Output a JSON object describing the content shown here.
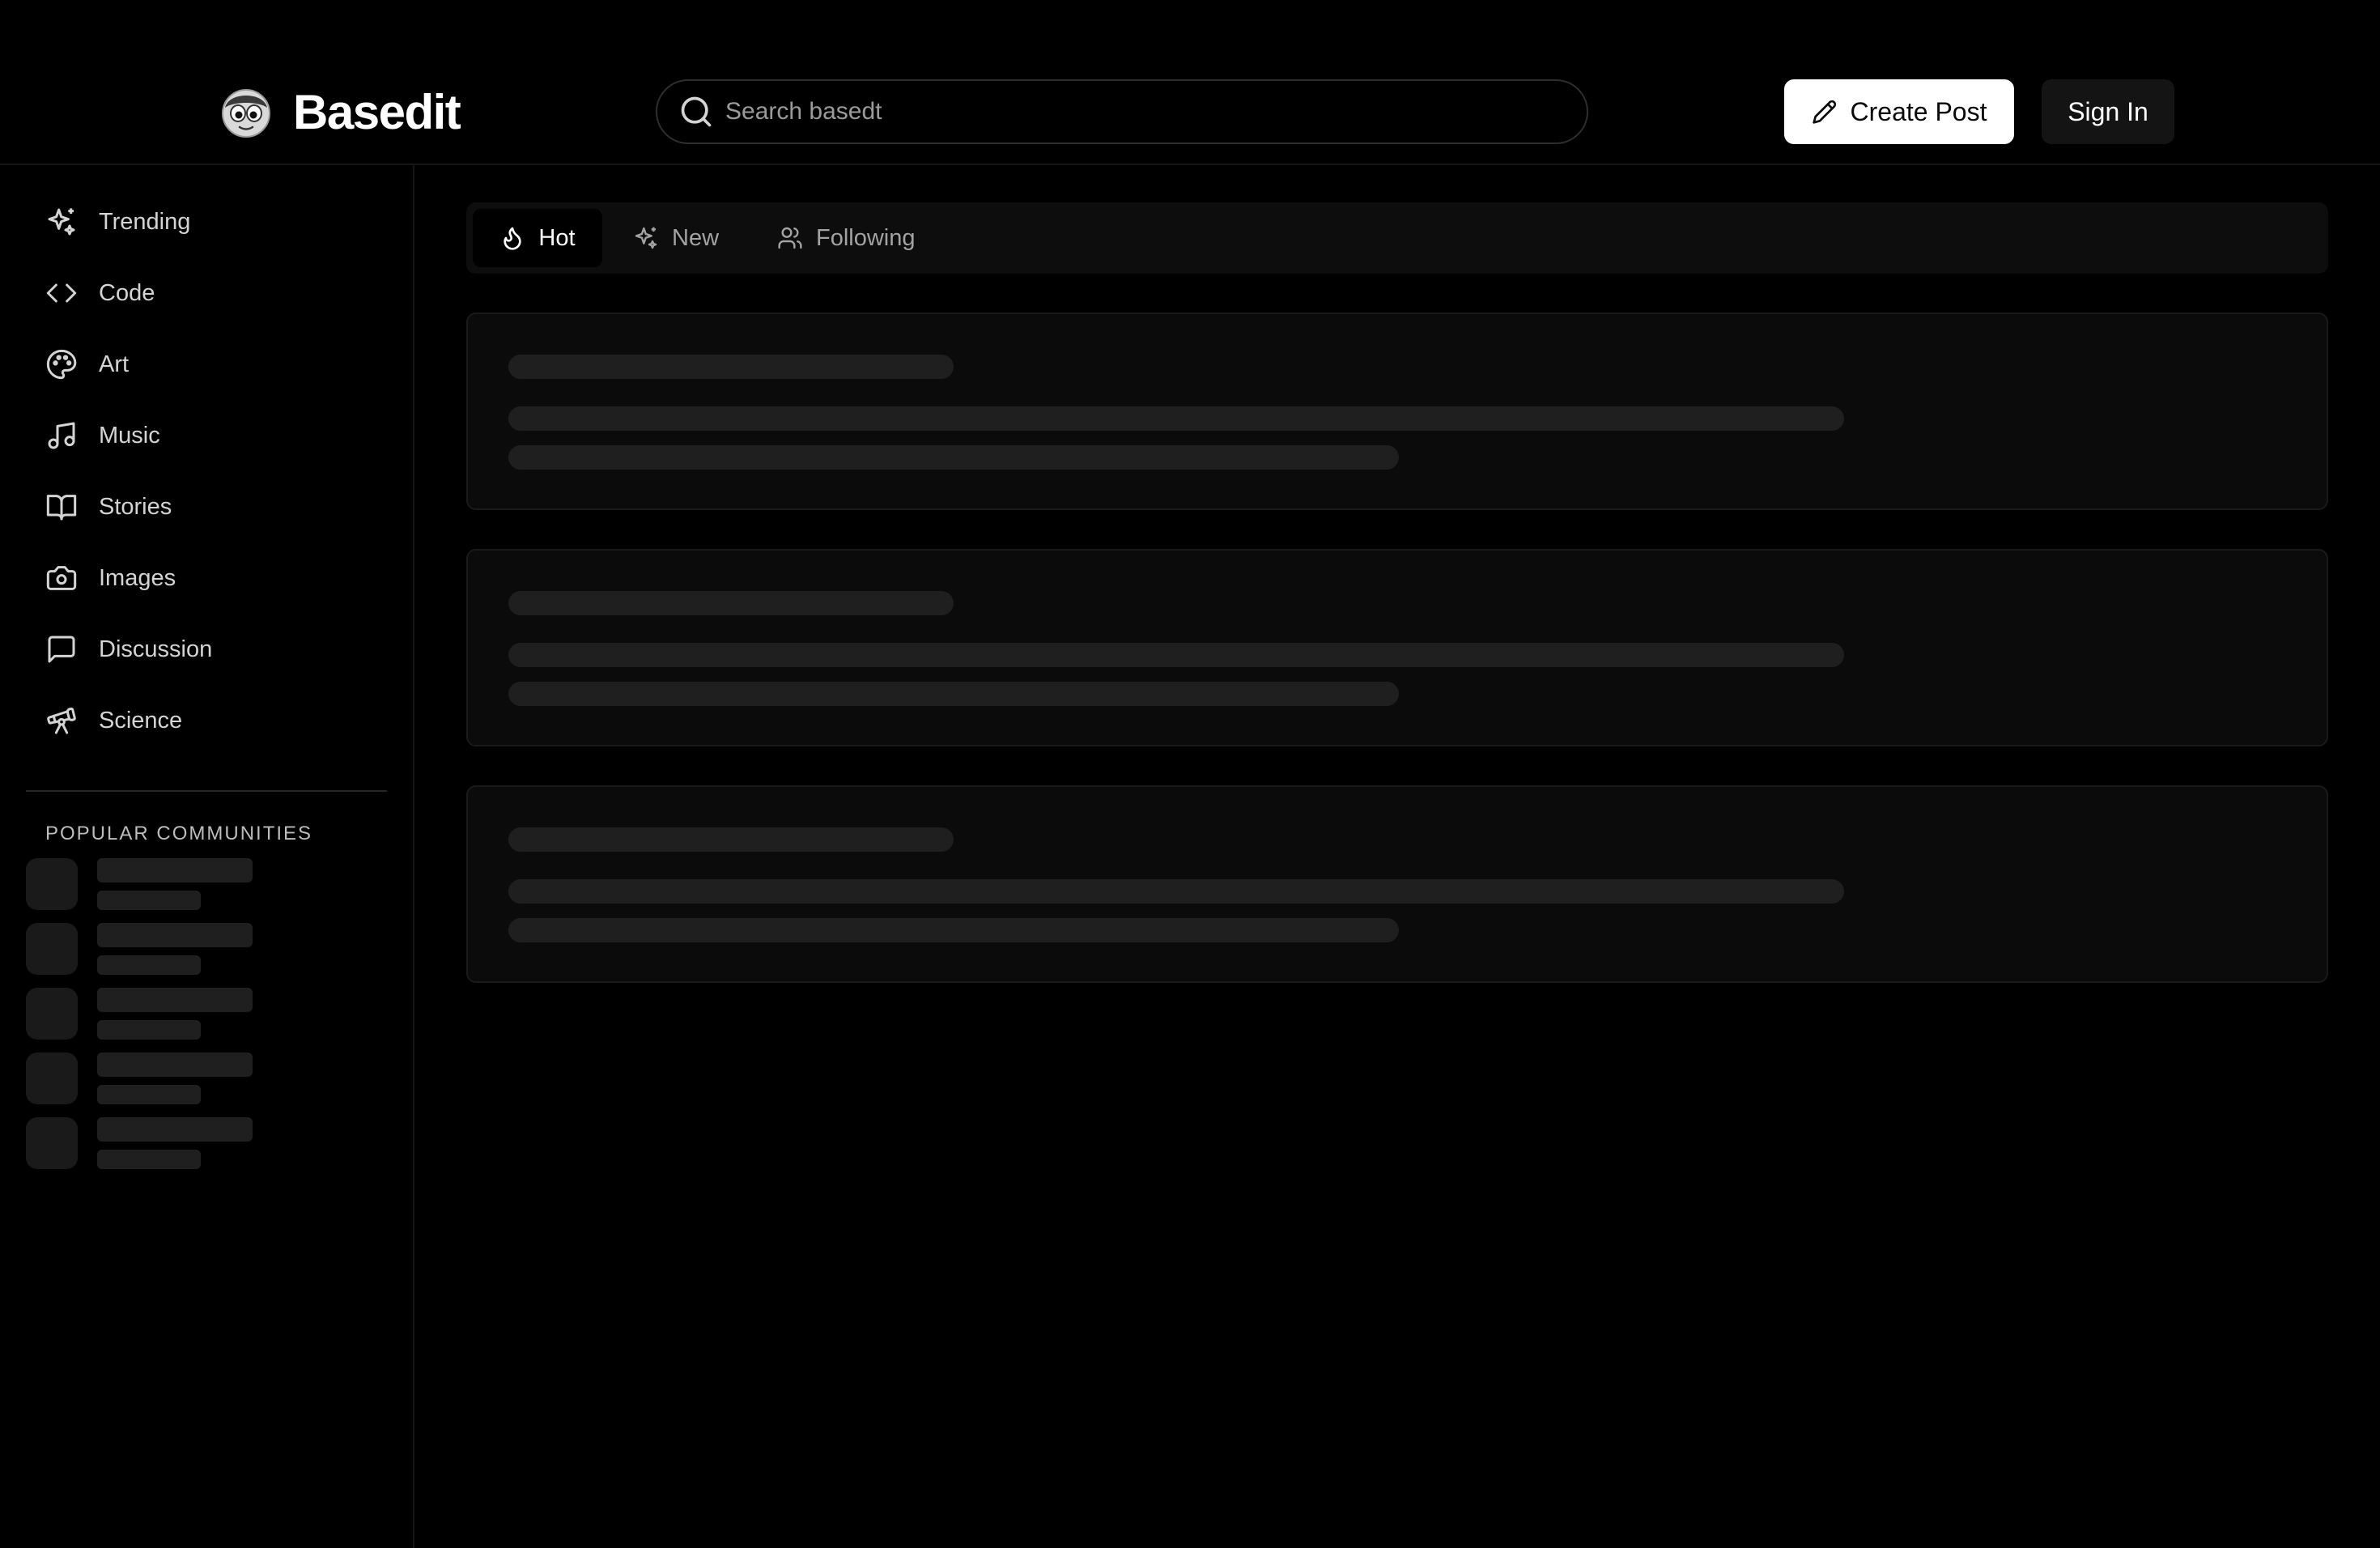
{
  "header": {
    "logo_text": "Basedit",
    "search_placeholder": "Search basedt",
    "create_post_label": "Create Post",
    "sign_in_label": "Sign In"
  },
  "sidebar": {
    "items": [
      {
        "label": "Trending",
        "icon": "sparkles-icon"
      },
      {
        "label": "Code",
        "icon": "code-icon"
      },
      {
        "label": "Art",
        "icon": "palette-icon"
      },
      {
        "label": "Music",
        "icon": "music-note-icon"
      },
      {
        "label": "Stories",
        "icon": "book-open-icon"
      },
      {
        "label": "Images",
        "icon": "camera-icon"
      },
      {
        "label": "Discussion",
        "icon": "message-square-icon"
      },
      {
        "label": "Science",
        "icon": "telescope-icon"
      }
    ],
    "popular_title": "POPULAR COMMUNITIES"
  },
  "feed": {
    "tabs": [
      {
        "label": "Hot",
        "icon": "flame-icon",
        "active": true
      },
      {
        "label": "New",
        "icon": "sparkles-icon",
        "active": false
      },
      {
        "label": "Following",
        "icon": "users-icon",
        "active": false
      }
    ]
  },
  "colors": {
    "background": "#000000",
    "surface": "#0d0d0d",
    "skeleton": "#1f1f1f",
    "primary_button": "#ffffff"
  }
}
